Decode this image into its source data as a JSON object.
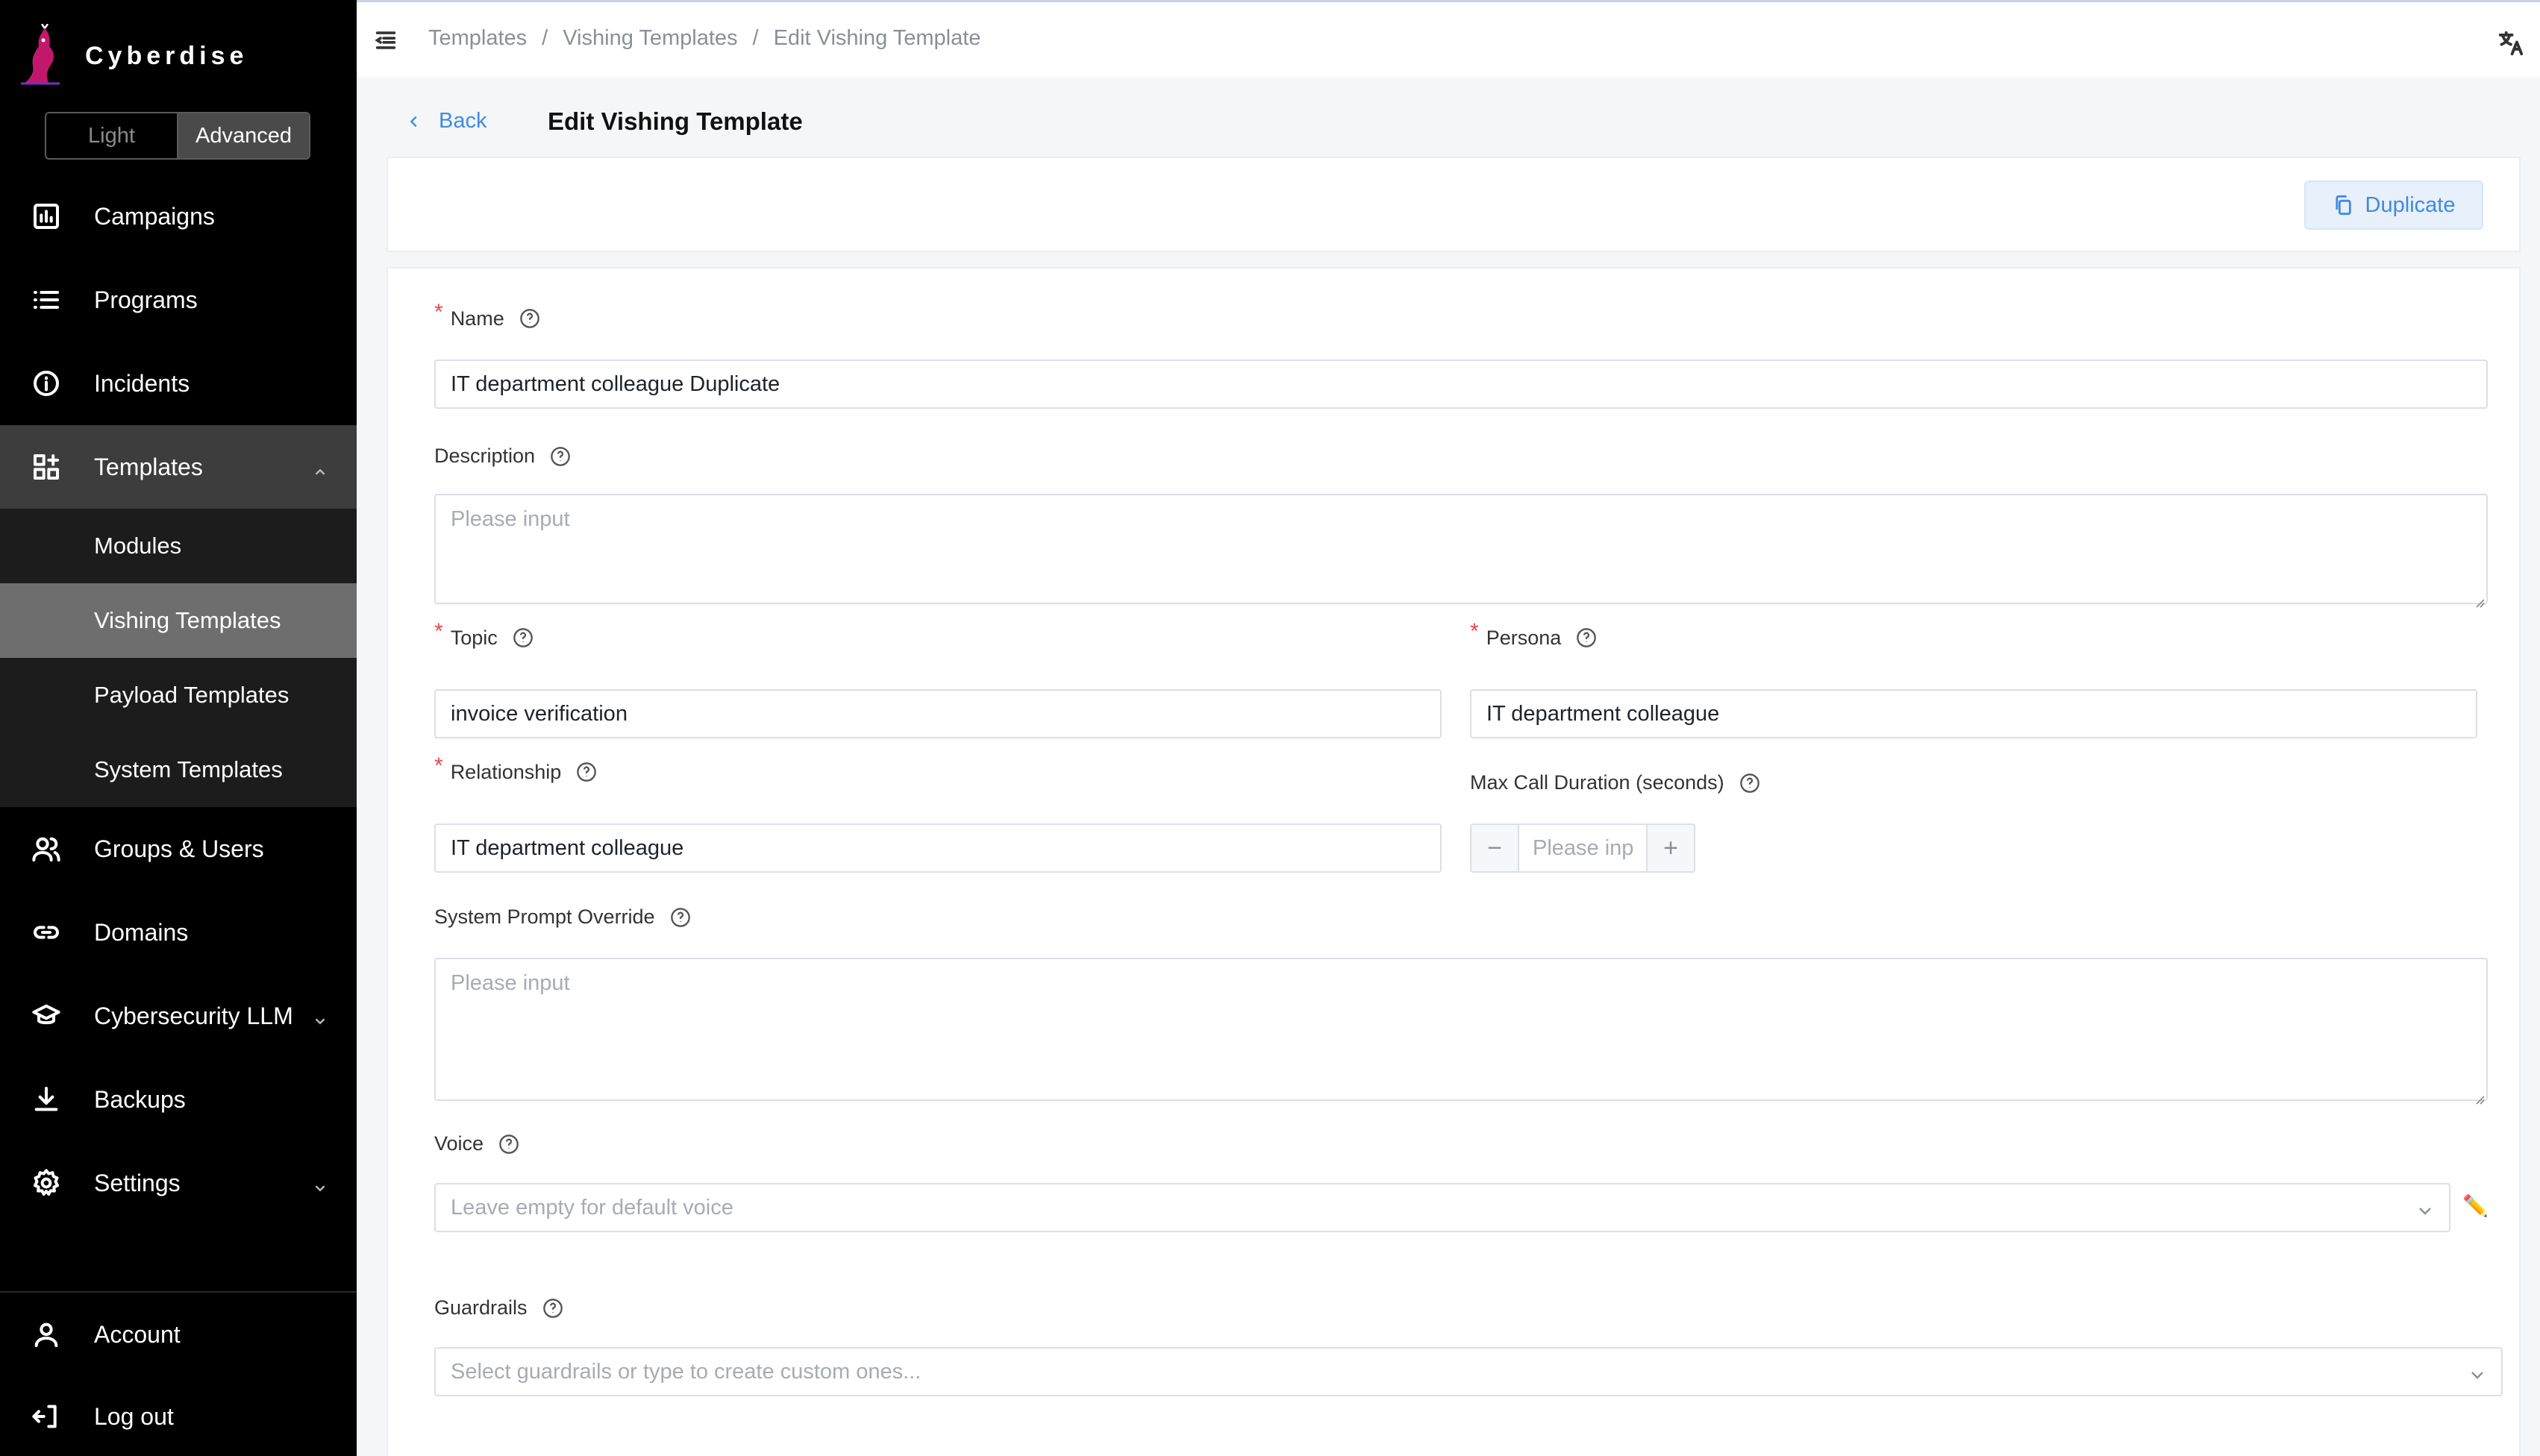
{
  "brand": {
    "name": "Cyberdise"
  },
  "mode_toggle": {
    "light": "Light",
    "advanced": "Advanced",
    "selected": "Advanced"
  },
  "sidebar": {
    "items": [
      {
        "label": "Campaigns",
        "icon": "bar-chart-icon"
      },
      {
        "label": "Programs",
        "icon": "list-icon"
      },
      {
        "label": "Incidents",
        "icon": "info-circle-icon"
      },
      {
        "label": "Templates",
        "icon": "grid-plus-icon",
        "expanded": true
      },
      {
        "label": "Groups & Users",
        "icon": "users-icon"
      },
      {
        "label": "Domains",
        "icon": "link-icon"
      },
      {
        "label": "Cybersecurity LLM",
        "icon": "graduation-cap-icon"
      },
      {
        "label": "Backups",
        "icon": "download-icon"
      },
      {
        "label": "Settings",
        "icon": "gear-icon"
      }
    ],
    "template_subitems": [
      {
        "label": "Modules"
      },
      {
        "label": "Vishing Templates",
        "active": true
      },
      {
        "label": "Payload Templates"
      },
      {
        "label": "System Templates"
      }
    ],
    "bottom": [
      {
        "label": "Account",
        "icon": "user-icon"
      },
      {
        "label": "Log out",
        "icon": "logout-icon"
      }
    ]
  },
  "breadcrumb": [
    "Templates",
    "Vishing Templates",
    "Edit Vishing Template"
  ],
  "page": {
    "back": "Back",
    "title": "Edit Vishing Template",
    "duplicate": "Duplicate"
  },
  "form": {
    "name": {
      "label": "Name",
      "required": true,
      "value": "IT department colleague Duplicate"
    },
    "description": {
      "label": "Description",
      "placeholder": "Please input"
    },
    "topic": {
      "label": "Topic",
      "required": true,
      "value": "invoice verification"
    },
    "persona": {
      "label": "Persona",
      "required": true,
      "value": "IT department colleague"
    },
    "relationship": {
      "label": "Relationship",
      "required": true,
      "value": "IT department colleague"
    },
    "max_call_duration": {
      "label": "Max Call Duration (seconds)",
      "placeholder": "Please inp"
    },
    "system_prompt": {
      "label": "System Prompt Override",
      "placeholder": "Please input"
    },
    "voice": {
      "label": "Voice",
      "placeholder": "Leave empty for default voice"
    },
    "guardrails": {
      "label": "Guardrails",
      "placeholder": "Select guardrails or type to create custom ones..."
    }
  },
  "colors": {
    "accent": "#3f8bdf",
    "sidebar_bg": "#000000",
    "active_item": "#6e6e6e",
    "required": "#e5484d"
  }
}
